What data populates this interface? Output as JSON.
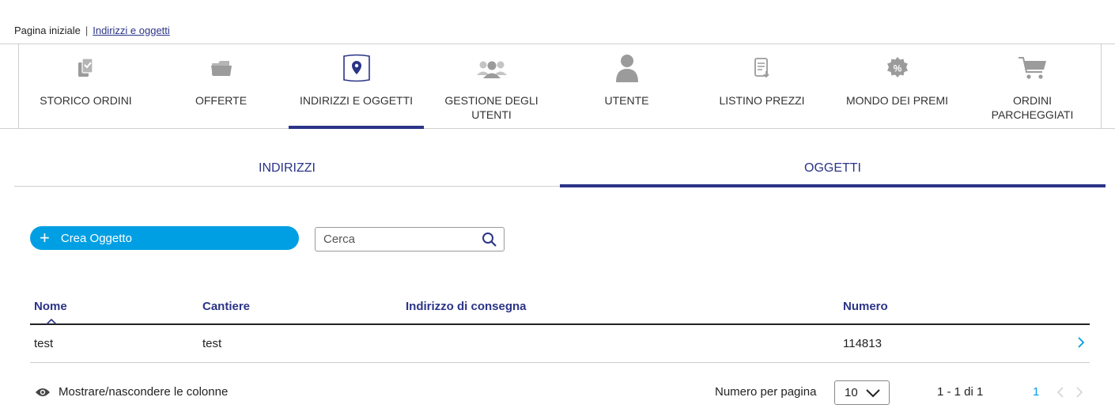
{
  "breadcrumb": {
    "home": "Pagina iniziale",
    "separator": "|",
    "current": "Indirizzi e oggetti"
  },
  "nav": {
    "items": [
      {
        "label": "STORICO ORDINI",
        "icon": "clipboard-check-icon"
      },
      {
        "label": "OFFERTE",
        "icon": "folder-icon"
      },
      {
        "label": "INDIRIZZI E OGGETTI",
        "icon": "map-pin-icon",
        "active": true
      },
      {
        "label": "GESTIONE DEGLI UTENTI",
        "icon": "users-group-icon"
      },
      {
        "label": "UTENTE",
        "icon": "user-icon"
      },
      {
        "label": "LISTINO PREZZI",
        "icon": "price-list-icon"
      },
      {
        "label": "MONDO DEI PREMI",
        "icon": "percent-badge-icon"
      },
      {
        "label": "ORDINI PARCHEGGIATI",
        "icon": "cart-icon"
      }
    ]
  },
  "subtabs": [
    {
      "label": "INDIRIZZI"
    },
    {
      "label": "OGGETTI",
      "active": true
    }
  ],
  "actions": {
    "create_label": "Crea Oggetto",
    "search_placeholder": "Cerca"
  },
  "table": {
    "columns": [
      "Nome",
      "Cantiere",
      "Indirizzo di consegna",
      "Numero"
    ],
    "sorted_column": "Nome",
    "sort_direction": "ascending",
    "rows": [
      {
        "nome": "test",
        "cantiere": "test",
        "indirizzo": "",
        "numero": "114813"
      }
    ]
  },
  "footer": {
    "toggle_columns": "Mostrare/nascondere le colonne",
    "per_page_label": "Numero per pagina",
    "per_page_value": "10",
    "range": "1 - 1 di 1",
    "current_page": "1"
  },
  "colors": {
    "brand_navy": "#2b3487",
    "accent_blue": "#009fe3",
    "icon_gray": "#9b9b9b"
  }
}
